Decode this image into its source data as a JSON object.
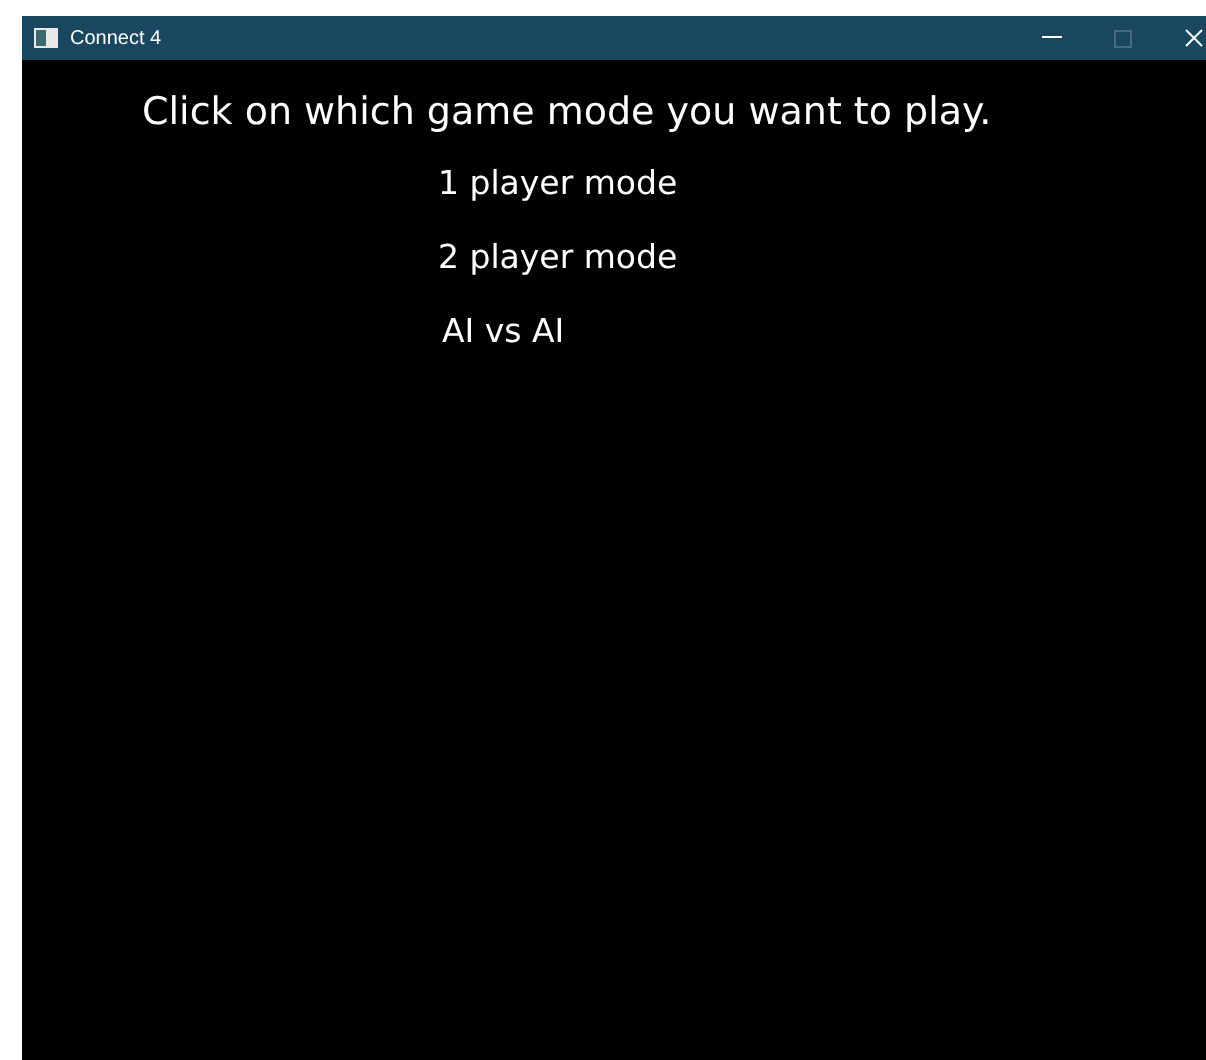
{
  "window": {
    "title": "Connect 4"
  },
  "heading": "Click on which game mode you want to play.",
  "modes": [
    {
      "label": "1 player mode"
    },
    {
      "label": "2 player mode"
    },
    {
      "label": "AI vs AI"
    }
  ],
  "controls": {
    "maximize_disabled": true
  }
}
